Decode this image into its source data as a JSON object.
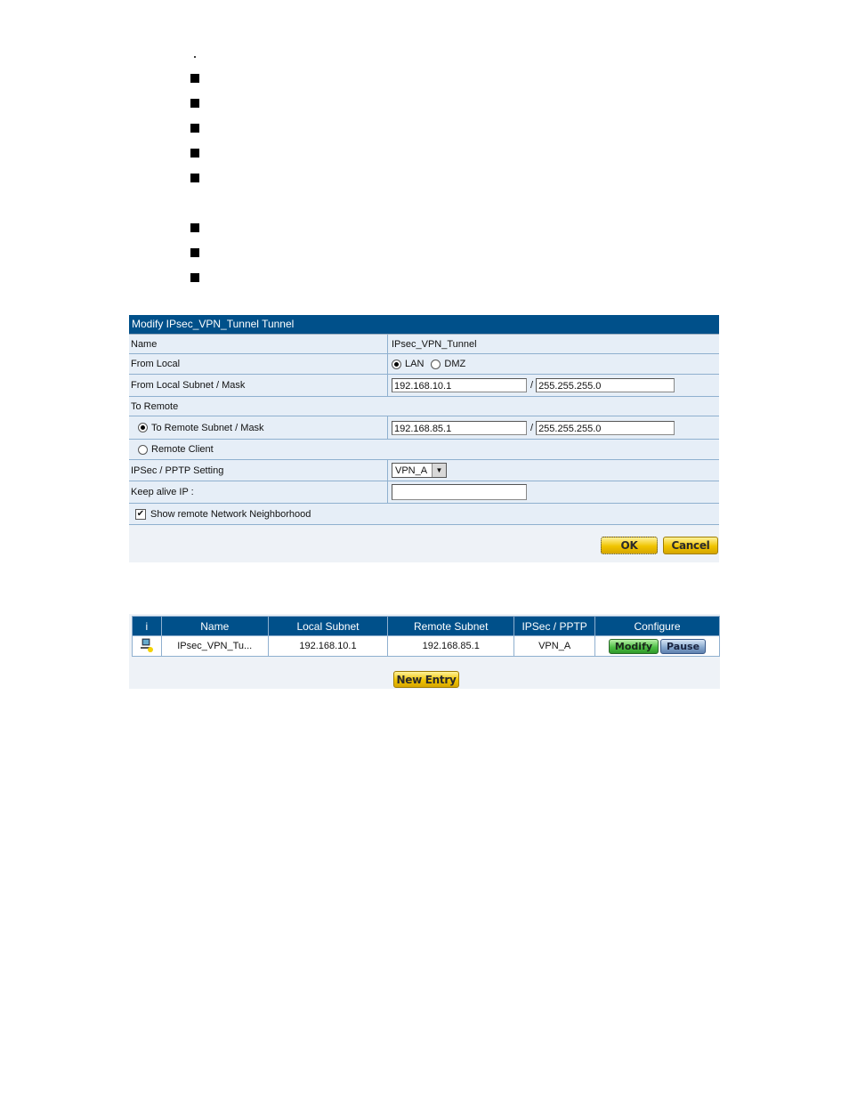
{
  "bullets": {
    "count_squares": 8
  },
  "modify_form": {
    "title": "Modify IPsec_VPN_Tunnel Tunnel",
    "rows": {
      "name": {
        "label": "Name",
        "value": "IPsec_VPN_Tunnel"
      },
      "from_local": {
        "label": "From Local",
        "options": [
          "LAN",
          "DMZ"
        ],
        "selected": "LAN"
      },
      "from_local_subnet": {
        "label": "From Local Subnet / Mask",
        "subnet": "192.168.10.1",
        "separator": "/",
        "mask": "255.255.255.0"
      },
      "to_remote": {
        "label": "To Remote"
      },
      "to_remote_subnet": {
        "label": "To Remote Subnet / Mask",
        "selected": true,
        "subnet": "192.168.85.1",
        "separator": "/",
        "mask": "255.255.255.0"
      },
      "remote_client": {
        "label": "Remote Client",
        "selected": false
      },
      "ipsec_pptp": {
        "label": "IPSec / PPTP Setting",
        "value": "VPN_A"
      },
      "keep_alive": {
        "label": "Keep alive IP :",
        "value": ""
      },
      "show_neighborhood": {
        "label": "Show remote Network Neighborhood",
        "checked": true
      }
    },
    "buttons": {
      "ok": "OK",
      "cancel": "Cancel"
    }
  },
  "tunnel_list": {
    "columns": [
      "i",
      "Name",
      "Local Subnet",
      "Remote Subnet",
      "IPSec / PPTP",
      "Configure"
    ],
    "rows": [
      {
        "icon": "computer-connection-icon",
        "name": "IPsec_VPN_Tu...",
        "local_subnet": "192.168.10.1",
        "remote_subnet": "192.168.85.1",
        "ipsec_pptp": "VPN_A",
        "actions": [
          "Modify",
          "Pause"
        ]
      }
    ],
    "new_entry": "New Entry"
  },
  "colors": {
    "header": "#00508a",
    "row": "#e6eef7",
    "border": "#8fb0cf",
    "ok_button": "#f0c400",
    "modify_button": "#4fc046",
    "pause_button": "#8aaad0"
  }
}
